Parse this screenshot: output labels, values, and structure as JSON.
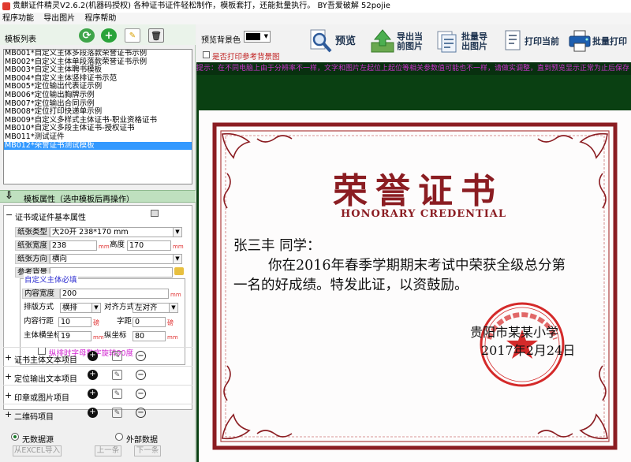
{
  "window": {
    "title": "贵麒证件精灵V2.6.2(机器码授权)       各种证书证件轻松制作，模板套打，还能批量执行。   BY吾爱破解 52pojie"
  },
  "menu": [
    "程序功能",
    "导出图片",
    "程序帮助"
  ],
  "template_panel": {
    "header": "模板列表",
    "templates": [
      "MB001*自定义主体多段落款荣誉证书示例",
      "MB002*自定义主体单段落款荣誉证书示例",
      "MB003*自定义主体聘书模板",
      "MB004*自定义主体竖排证书示范",
      "MB005*定位输出代表证示例",
      "MB006*定位输出胸牌示例",
      "MB007*定位输出合同示例",
      "MB008*定位打印快递单示例",
      "MB009*自定义多样式主体证书-职业资格证书",
      "MB010*自定义多段主体证书-授权证书",
      "MB011*测试证件",
      "MB012*荣誉证书测试模板"
    ],
    "selected_index": 11
  },
  "attributes": {
    "header": "模板属性（选中模板后再操作）",
    "section_title": "证书或证件基本属性",
    "paper_type_label": "纸张类型",
    "paper_type_value": "大20开 238*170 mm",
    "paper_width_label": "纸张宽度",
    "paper_width_value": "238",
    "paper_height_label": "高度",
    "paper_height_value": "170",
    "paper_dir_label": "纸张方向",
    "paper_dir_value": "横向",
    "bg_label": "参考背景",
    "bg_value": "",
    "unit_mm": "mm",
    "unit_px": "磅",
    "group_title": "自定义主体必填",
    "content_width_label": "内容宽度",
    "content_width_value": "200",
    "layout_label": "排版方式",
    "layout_value": "横排",
    "align_label": "对齐方式",
    "align_value": "左对齐",
    "line_spacing_label": "内容行距",
    "line_spacing_value": "10",
    "char_spacing_label": "字距",
    "char_spacing_value": "0",
    "x_label": "主体横坐标",
    "x_value": "19",
    "y_label": "纵坐标",
    "y_value": "80",
    "rotate_label": "纵排时字母数字旋转90度"
  },
  "collapsed_sections": [
    "证书主体文本项目",
    "定位输出文本项目",
    "印章或图片项目",
    "二维码项目"
  ],
  "data_source": {
    "no_source": "无数据源",
    "external": "外部数据",
    "import_btn": "从EXCEL导入",
    "prev_btn": "上一条",
    "next_btn": "下一条"
  },
  "toolbar": {
    "bg_color_label": "预览背景色",
    "bg_color_value": "#000000",
    "print_ref_bg": "是否打印参考背景图",
    "preview": "预览",
    "export_current_1": "导出当",
    "export_current_2": "前图片",
    "batch_export_1": "批量导",
    "batch_export_2": "出图片",
    "print_current": "打印当前",
    "batch_print": "批量打印"
  },
  "hint": "提示：在不同电脑上由于分辨率不一样，文字和图片左起位上起位等相关参数值可能也不一样，请做实调整，直到预览显示正常为止后保存",
  "certificate": {
    "title": "荣誉证书",
    "subtitle": "HONORARY CREDENTIAL",
    "line1": "张三丰  同学：",
    "line2": "你在2016年春季学期期末考试中荣获全级总分第",
    "line3": "一名的好成绩。特发此证，以资鼓励。",
    "school": "贵阳市某某小学",
    "date": "2017年2月24日",
    "seal_text": "贵阳市某某小学"
  }
}
